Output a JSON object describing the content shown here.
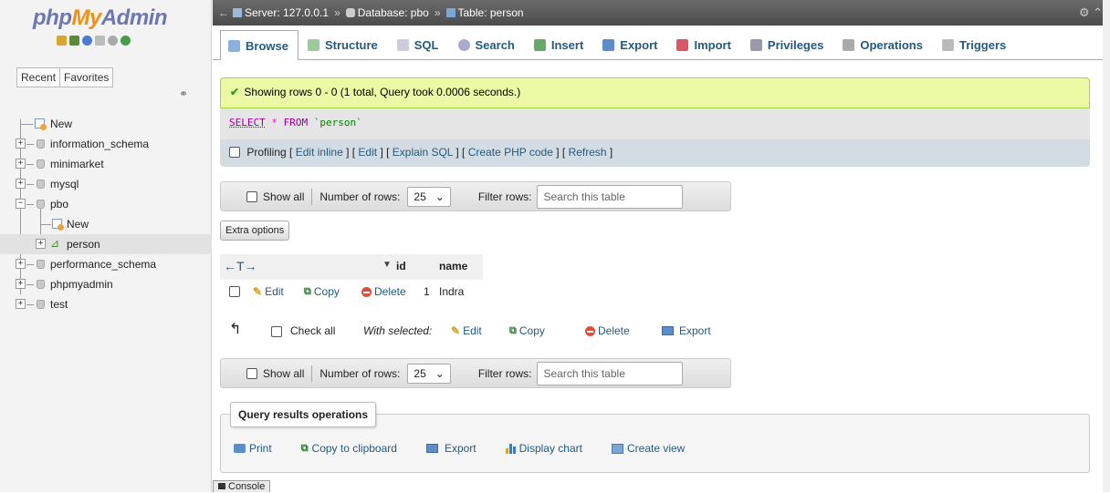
{
  "logo": {
    "php": "php",
    "my": "My",
    "admin": "Admin"
  },
  "nav_tabs": [
    "Recent",
    "Favorites"
  ],
  "tree": {
    "new": "New",
    "databases": [
      "information_schema",
      "minimarket",
      "mysql",
      "pbo"
    ],
    "pbo_children": {
      "new": "New",
      "table": "person"
    },
    "databases_after": [
      "performance_schema",
      "phpmyadmin",
      "test"
    ]
  },
  "breadcrumb": {
    "server": "Server: 127.0.0.1",
    "database": "Database: pbo",
    "table": "Table: person",
    "separator": "»"
  },
  "tabs": [
    "Browse",
    "Structure",
    "SQL",
    "Search",
    "Insert",
    "Export",
    "Import",
    "Privileges",
    "Operations",
    "Triggers"
  ],
  "active_tab": "Browse",
  "success_message": "Showing rows 0 - 0 (1 total, Query took 0.0006 seconds.)",
  "sql": {
    "select": "SELECT",
    "star": "*",
    "from": "FROM",
    "table": "`person`"
  },
  "profiling": {
    "label": "Profiling",
    "links": [
      "Edit inline",
      "Edit",
      "Explain SQL",
      "Create PHP code",
      "Refresh"
    ]
  },
  "navbar": {
    "show_all": "Show all",
    "rows_label": "Number of rows:",
    "rows_value": "25",
    "filter_label": "Filter rows:",
    "filter_placeholder": "Search this table"
  },
  "extra_options": "Extra options",
  "table": {
    "arrows": "←T→",
    "columns": [
      "id",
      "name"
    ],
    "rows": [
      {
        "edit": "Edit",
        "copy": "Copy",
        "delete": "Delete",
        "id": "1",
        "name": "Indra"
      }
    ]
  },
  "bulk": {
    "check_all": "Check all",
    "with_selected": "With selected:",
    "edit": "Edit",
    "copy": "Copy",
    "delete": "Delete",
    "export": "Export"
  },
  "query_results_operations": {
    "title": "Query results operations",
    "items": [
      "Print",
      "Copy to clipboard",
      "Export",
      "Display chart",
      "Create view"
    ]
  },
  "console": "Console"
}
